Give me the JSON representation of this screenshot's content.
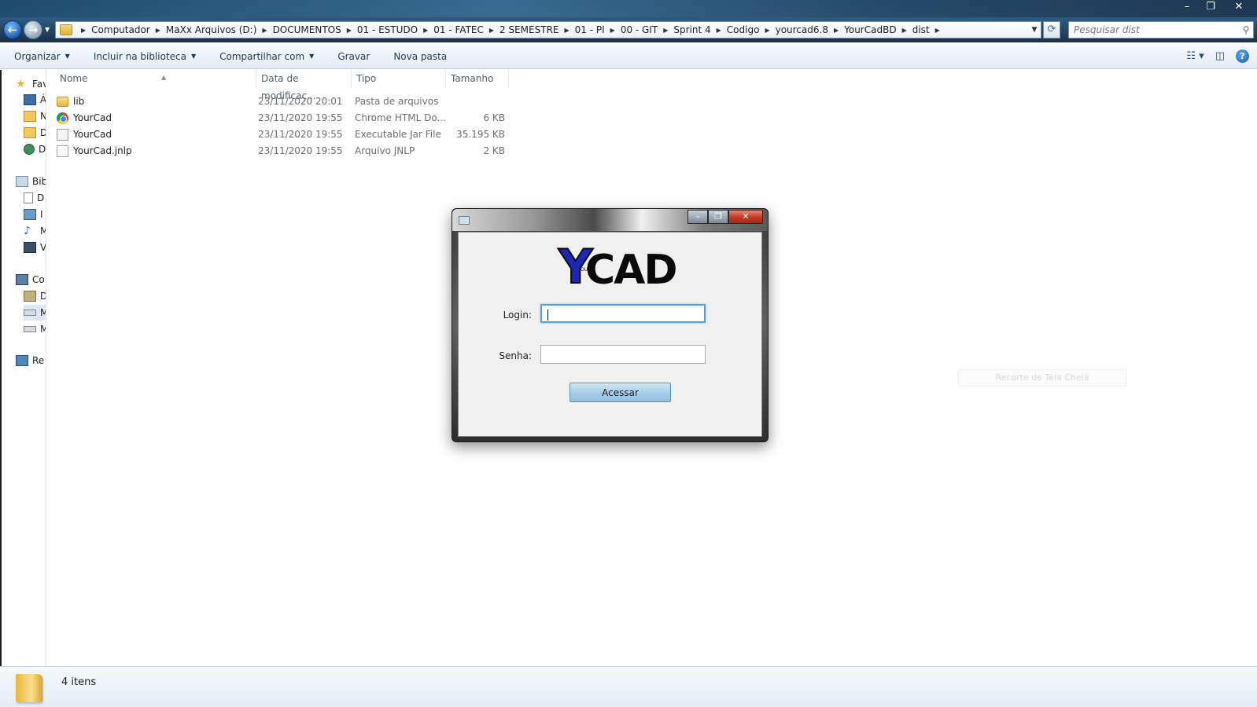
{
  "window": {
    "minimize": "–",
    "maximize": "❐",
    "close": "✕"
  },
  "address": {
    "crumbs": [
      "Computador",
      "MaXx Arquivos (D:)",
      "DOCUMENTOS",
      "01 - ESTUDO",
      "01 - FATEC",
      "2 SEMESTRE",
      "01 - PI",
      "00 - GIT",
      "Sprint 4",
      "Codigo",
      "yourcad6.8",
      "YourCadBD",
      "dist"
    ]
  },
  "search": {
    "placeholder": "Pesquisar dist"
  },
  "toolbar": {
    "organize": "Organizar",
    "include_library": "Incluir na biblioteca",
    "share": "Compartilhar com",
    "burn": "Gravar",
    "new_folder": "Nova pasta"
  },
  "navpane": {
    "favorites": "Fav",
    "fav_items": [
      "Á",
      "N",
      "D",
      "D"
    ],
    "libraries": "Bib",
    "lib_items": [
      "D",
      "I",
      "M",
      "V"
    ],
    "computer": "Co",
    "comp_items": [
      "D",
      "M",
      "M"
    ],
    "network": "Re"
  },
  "files": {
    "headers": {
      "name": "Nome",
      "date": "Data de modificaç...",
      "type": "Tipo",
      "size": "Tamanho"
    },
    "rows": [
      {
        "name": "lib",
        "date": "23/11/2020 20:01",
        "type": "Pasta de arquivos",
        "size": "",
        "icon": "folder-icon"
      },
      {
        "name": "YourCad",
        "date": "23/11/2020 19:55",
        "type": "Chrome HTML Do...",
        "size": "6 KB",
        "icon": "chrome-html-icon"
      },
      {
        "name": "YourCad",
        "date": "23/11/2020 19:55",
        "type": "Executable Jar File",
        "size": "35.195 KB",
        "icon": "jar-file-icon"
      },
      {
        "name": "YourCad.jnlp",
        "date": "23/11/2020 19:55",
        "type": "Arquivo JNLP",
        "size": "2 KB",
        "icon": "blank-file-icon"
      }
    ]
  },
  "snip_button": "Recorte de Tela Cheia",
  "status": {
    "count": "4 itens"
  },
  "dialog": {
    "logo_y": "Y",
    "logo_small": "OUR",
    "logo_cad": "CAD",
    "login_label": "Login:",
    "login_value": "",
    "password_label": "Senha:",
    "password_value": "",
    "submit": "Acessar"
  }
}
